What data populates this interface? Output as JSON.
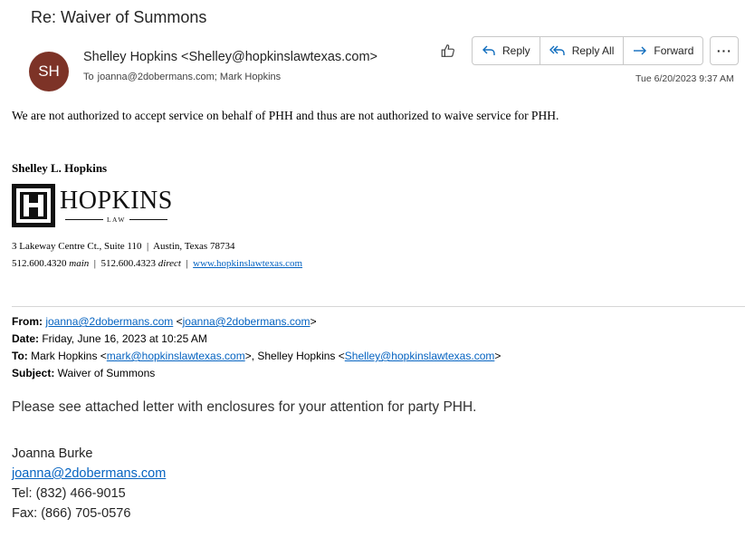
{
  "subject": "Re: Waiver of Summons",
  "sender": {
    "initials": "SH",
    "avatar_color": "#7d3327",
    "display": "Shelley Hopkins <Shelley@hopkinslawtexas.com>",
    "to_label": "To",
    "to": "joanna@2dobermans.com; Mark Hopkins",
    "timestamp": "Tue 6/20/2023 9:37 AM"
  },
  "toolbar": {
    "like_icon": "thumbs-up-icon",
    "reply_label": "Reply",
    "reply_all_label": "Reply All",
    "forward_label": "Forward",
    "more_label": "···"
  },
  "reply": {
    "body": "We are not authorized to accept service on behalf of PHH and thus are not authorized to waive service for PHH."
  },
  "signature": {
    "name": "Shelley L. Hopkins",
    "logo_word": "HOPKINS",
    "logo_sub": "LAW",
    "address": "3 Lakeway Centre Ct., Suite 110  |  Austin, Texas 78734",
    "phone_main": "512.600.4320",
    "main_label": "main",
    "sep": "  |  ",
    "phone_direct": "512.600.4323",
    "direct_label": "direct",
    "website": "www.hopkinslawtexas.com"
  },
  "forwarded": {
    "from_label": "From:",
    "from_email": "joanna@2dobermans.com",
    "from_lt": " <",
    "from_email2": "joanna@2dobermans.com",
    "from_gt": ">",
    "date_label": "Date:",
    "date": " Friday, June 16, 2023 at 10:25 AM",
    "to_label": "To:",
    "to_name1": " Mark Hopkins <",
    "to_email1": "mark@hopkinslawtexas.com",
    "to_mid": ">, Shelley Hopkins <",
    "to_email2": "Shelley@hopkinslawtexas.com",
    "to_end": ">",
    "subject_label": "Subject:",
    "subject": " Waiver of Summons",
    "body": "Please see attached letter with enclosures for your attention for party PHH."
  },
  "joanna": {
    "name": "Joanna Burke",
    "email": "joanna@2dobermans.com",
    "tel": "Tel: (832) 466-9015",
    "fax": "Fax: (866) 705-0576"
  },
  "colors": {
    "link": "#0563c1",
    "accent": "#0f6cbd"
  }
}
